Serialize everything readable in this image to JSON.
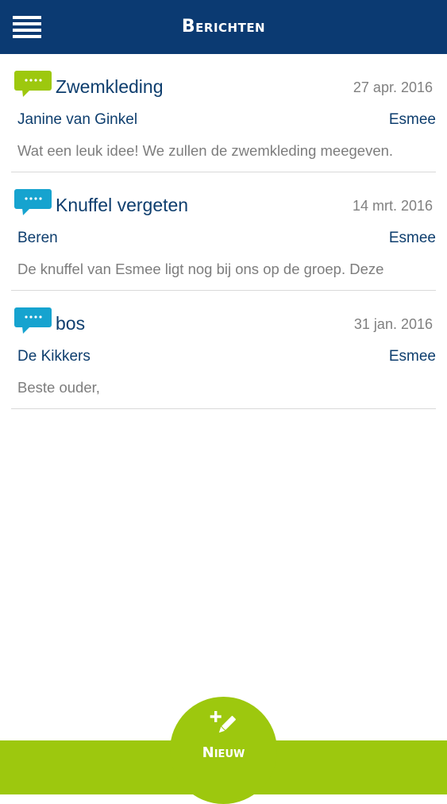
{
  "header": {
    "title": "Berichten"
  },
  "colors": {
    "header_bg": "#0b3a72",
    "accent_green": "#9dc80e",
    "accent_blue": "#16a3cf",
    "text_dark_blue": "#0e3e6e",
    "text_gray": "#7d7d7d"
  },
  "messages": [
    {
      "icon": "green-speech-bubble-icon",
      "title": "Zwemkleding",
      "date": "27 apr. 2016",
      "sender": "Janine van Ginkel",
      "recipient": "Esmee",
      "preview": "Wat een leuk idee! We zullen de zwemkleding meegeven."
    },
    {
      "icon": "blue-speech-bubble-icon",
      "title": "Knuffel vergeten",
      "date": "14 mrt. 2016",
      "sender": "Beren",
      "recipient": "Esmee",
      "preview": "De knuffel van Esmee ligt nog bij ons op de groep. Deze"
    },
    {
      "icon": "blue-speech-bubble-icon",
      "title": "bos",
      "date": "31 jan. 2016",
      "sender": "De Kikkers",
      "recipient": "Esmee",
      "preview": "Beste ouder,"
    }
  ],
  "footer": {
    "new_label": "Nieuw",
    "new_icon": "pencil-plus-icon"
  }
}
